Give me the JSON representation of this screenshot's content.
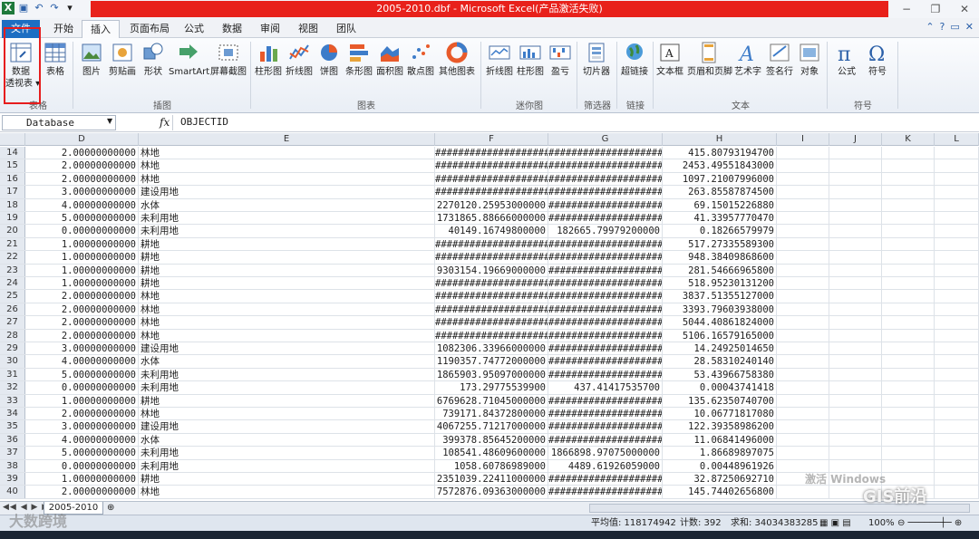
{
  "window": {
    "title": "2005-2010.dbf - Microsoft Excel(产品激活失败)"
  },
  "ribbon": {
    "tabs": [
      "文件",
      "开始",
      "插入",
      "页面布局",
      "公式",
      "数据",
      "审阅",
      "视图",
      "团队"
    ],
    "active_tab": "插入",
    "buttons": {
      "pivot1": "数据",
      "pivot2": "透视表 ▾",
      "table": "表格",
      "picture": "图片",
      "clipart": "剪贴画",
      "shapes": "形状",
      "smartart": "SmartArt",
      "screenshot": "屏幕截图",
      "column": "柱形图",
      "line": "折线图",
      "pie": "饼图",
      "bar": "条形图",
      "area": "面积图",
      "scatter": "散点图",
      "other": "其他图表",
      "spark_line": "折线图",
      "spark_column": "柱形图",
      "winloss": "盈亏",
      "slicer": "切片器",
      "hyperlink": "超链接",
      "textbox": "文本框",
      "header": "页眉和页脚",
      "wordart": "艺术字",
      "signature": "签名行",
      "object": "对象",
      "equation": "公式",
      "symbol": "符号"
    },
    "groups": {
      "tables": "表格",
      "illustrations": "插图",
      "charts": "图表",
      "sparklines": "迷你图",
      "filter": "筛选器",
      "links": "链接",
      "text": "文本",
      "symbols": "符号"
    }
  },
  "formula_bar": {
    "name_box": "Database",
    "fx": "fx",
    "content": "OBJECTID"
  },
  "columns": [
    "D",
    "E",
    "F",
    "G",
    "H",
    "I",
    "J",
    "K",
    "L"
  ],
  "rows": [
    {
      "n": "14",
      "D": "2.00000000000",
      "E": "林地",
      "F": "####################",
      "G": "####################",
      "H": "415.80793194700"
    },
    {
      "n": "15",
      "D": "2.00000000000",
      "E": "林地",
      "F": "####################",
      "G": "####################",
      "H": "2453.49551843000"
    },
    {
      "n": "16",
      "D": "2.00000000000",
      "E": "林地",
      "F": "####################",
      "G": "####################",
      "H": "1097.21007996000"
    },
    {
      "n": "17",
      "D": "3.00000000000",
      "E": "建设用地",
      "F": "####################",
      "G": "####################",
      "H": "263.85587874500"
    },
    {
      "n": "18",
      "D": "4.00000000000",
      "E": "水体",
      "F": "2270120.25953000000",
      "G": "####################",
      "H": "69.15015226880"
    },
    {
      "n": "19",
      "D": "5.00000000000",
      "E": "未利用地",
      "F": "1731865.88666000000",
      "G": "####################",
      "H": "41.33957770470"
    },
    {
      "n": "20",
      "D": "0.00000000000",
      "E": "未利用地",
      "F": "40149.16749800000",
      "G": "182665.79979200000",
      "H": "0.18266579979"
    },
    {
      "n": "21",
      "D": "1.00000000000",
      "E": "耕地",
      "F": "####################",
      "G": "####################",
      "H": "517.27335589300"
    },
    {
      "n": "22",
      "D": "1.00000000000",
      "E": "耕地",
      "F": "####################",
      "G": "####################",
      "H": "948.38409868600"
    },
    {
      "n": "23",
      "D": "1.00000000000",
      "E": "耕地",
      "F": "9303154.19669000000",
      "G": "####################",
      "H": "281.54666965800"
    },
    {
      "n": "24",
      "D": "1.00000000000",
      "E": "耕地",
      "F": "####################",
      "G": "####################",
      "H": "518.95230131200"
    },
    {
      "n": "25",
      "D": "2.00000000000",
      "E": "林地",
      "F": "####################",
      "G": "####################",
      "H": "3837.51355127000"
    },
    {
      "n": "26",
      "D": "2.00000000000",
      "E": "林地",
      "F": "####################",
      "G": "####################",
      "H": "3393.79603938000"
    },
    {
      "n": "27",
      "D": "2.00000000000",
      "E": "林地",
      "F": "####################",
      "G": "####################",
      "H": "5044.40861824000"
    },
    {
      "n": "28",
      "D": "2.00000000000",
      "E": "林地",
      "F": "####################",
      "G": "####################",
      "H": "5106.16579165000"
    },
    {
      "n": "29",
      "D": "3.00000000000",
      "E": "建设用地",
      "F": "1082306.33966000000",
      "G": "####################",
      "H": "14.24925014650"
    },
    {
      "n": "30",
      "D": "4.00000000000",
      "E": "水体",
      "F": "1190357.74772000000",
      "G": "####################",
      "H": "28.58310240140"
    },
    {
      "n": "31",
      "D": "5.00000000000",
      "E": "未利用地",
      "F": "1865903.95097000000",
      "G": "####################",
      "H": "53.43966758380"
    },
    {
      "n": "32",
      "D": "0.00000000000",
      "E": "未利用地",
      "F": "173.29775539900",
      "G": "437.41417535700",
      "H": "0.00043741418"
    },
    {
      "n": "33",
      "D": "1.00000000000",
      "E": "耕地",
      "F": "6769628.71045000000",
      "G": "####################",
      "H": "135.62350740700"
    },
    {
      "n": "34",
      "D": "2.00000000000",
      "E": "林地",
      "F": "739171.84372800000",
      "G": "####################",
      "H": "10.06771817080"
    },
    {
      "n": "35",
      "D": "3.00000000000",
      "E": "建设用地",
      "F": "4067255.71217000000",
      "G": "####################",
      "H": "122.39358986200"
    },
    {
      "n": "36",
      "D": "4.00000000000",
      "E": "水体",
      "F": "399378.85645200000",
      "G": "####################",
      "H": "11.06841496000"
    },
    {
      "n": "37",
      "D": "5.00000000000",
      "E": "未利用地",
      "F": "108541.48609600000",
      "G": "1866898.97075000000",
      "H": "1.86689897075"
    },
    {
      "n": "38",
      "D": "0.00000000000",
      "E": "未利用地",
      "F": "1058.60786989000",
      "G": "4489.61926059000",
      "H": "0.00448961926"
    },
    {
      "n": "39",
      "D": "1.00000000000",
      "E": "耕地",
      "F": "2351039.22411000000",
      "G": "####################",
      "H": "32.87250692710"
    },
    {
      "n": "40",
      "D": "2.00000000000",
      "E": "林地",
      "F": "7572876.09363000000",
      "G": "####################",
      "H": "145.74402656800"
    }
  ],
  "sheet_tab": "2005-2010",
  "status_bar": {
    "average": "平均值: 118174942",
    "count": "计数: 392",
    "sum": "求和: 34034383285",
    "zoom": "100%"
  },
  "watermarks": {
    "left": "大数跨境",
    "right": "GIS前沿",
    "activate": "激活 Windows"
  }
}
